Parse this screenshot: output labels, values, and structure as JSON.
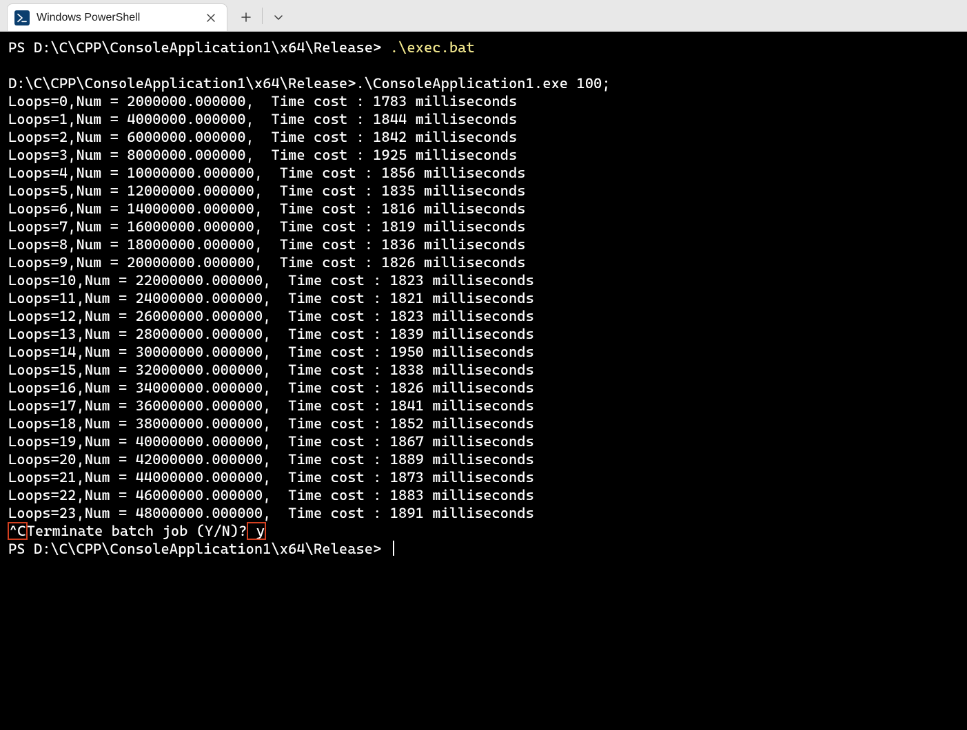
{
  "titlebar": {
    "tab_title": "Windows PowerShell"
  },
  "terminal": {
    "prompt1_prefix": "PS D:\\C\\CPP\\ConsoleApplication1\\x64\\Release> ",
    "prompt1_cmd": ".\\exec.bat",
    "batch_echo": "D:\\C\\CPP\\ConsoleApplication1\\x64\\Release>.\\ConsoleApplication1.exe 100;",
    "loops": [
      {
        "i": 0,
        "num": "2000000.000000",
        "ms": 1783
      },
      {
        "i": 1,
        "num": "4000000.000000",
        "ms": 1844
      },
      {
        "i": 2,
        "num": "6000000.000000",
        "ms": 1842
      },
      {
        "i": 3,
        "num": "8000000.000000",
        "ms": 1925
      },
      {
        "i": 4,
        "num": "10000000.000000",
        "ms": 1856
      },
      {
        "i": 5,
        "num": "12000000.000000",
        "ms": 1835
      },
      {
        "i": 6,
        "num": "14000000.000000",
        "ms": 1816
      },
      {
        "i": 7,
        "num": "16000000.000000",
        "ms": 1819
      },
      {
        "i": 8,
        "num": "18000000.000000",
        "ms": 1836
      },
      {
        "i": 9,
        "num": "20000000.000000",
        "ms": 1826
      },
      {
        "i": 10,
        "num": "22000000.000000",
        "ms": 1823
      },
      {
        "i": 11,
        "num": "24000000.000000",
        "ms": 1821
      },
      {
        "i": 12,
        "num": "26000000.000000",
        "ms": 1823
      },
      {
        "i": 13,
        "num": "28000000.000000",
        "ms": 1839
      },
      {
        "i": 14,
        "num": "30000000.000000",
        "ms": 1950
      },
      {
        "i": 15,
        "num": "32000000.000000",
        "ms": 1838
      },
      {
        "i": 16,
        "num": "34000000.000000",
        "ms": 1826
      },
      {
        "i": 17,
        "num": "36000000.000000",
        "ms": 1841
      },
      {
        "i": 18,
        "num": "38000000.000000",
        "ms": 1852
      },
      {
        "i": 19,
        "num": "40000000.000000",
        "ms": 1867
      },
      {
        "i": 20,
        "num": "42000000.000000",
        "ms": 1889
      },
      {
        "i": 21,
        "num": "44000000.000000",
        "ms": 1873
      },
      {
        "i": 22,
        "num": "46000000.000000",
        "ms": 1883
      },
      {
        "i": 23,
        "num": "48000000.000000",
        "ms": 1891
      }
    ],
    "ctrl_c": "^C",
    "terminate_text": "Terminate batch job (Y/N)?",
    "terminate_answer": " y",
    "prompt2_prefix": "PS D:\\C\\CPP\\ConsoleApplication1\\x64\\Release> "
  },
  "highlights": {
    "ctrl_c": "#d44020",
    "answer": "#d44020"
  }
}
